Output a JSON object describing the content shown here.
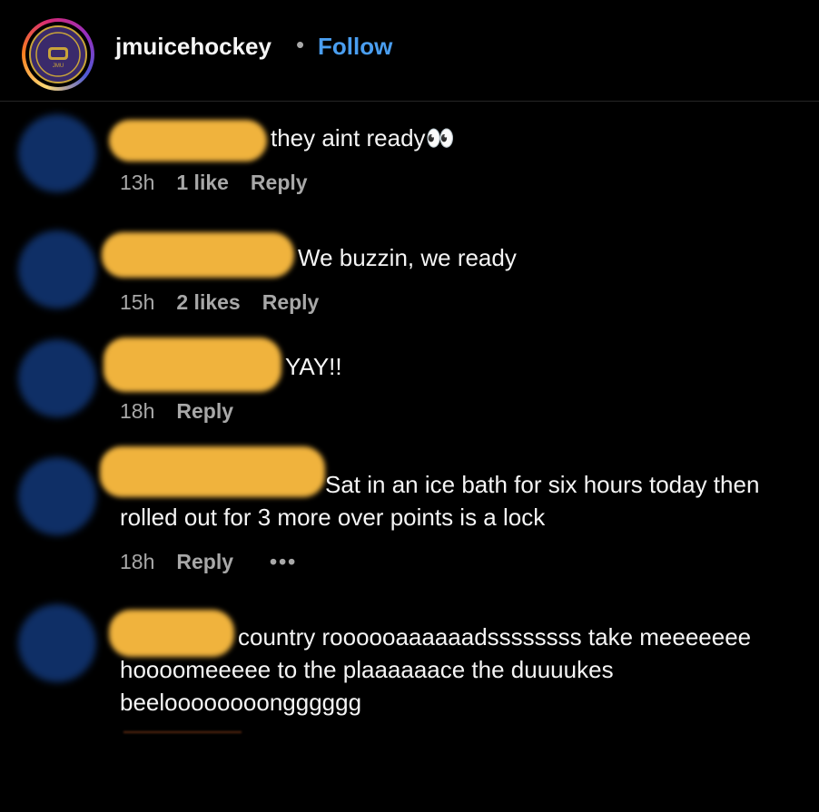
{
  "header": {
    "username": "jmuicehockey",
    "separator": "•",
    "follow_label": "Follow"
  },
  "comments": [
    {
      "text": "they aint ready👀",
      "time": "13h",
      "likes": "1 like",
      "reply": "Reply"
    },
    {
      "text": "We buzzin, we ready",
      "time": "15h",
      "likes": "2 likes",
      "reply": "Reply"
    },
    {
      "text": "YAY!!",
      "time": "18h",
      "reply": "Reply"
    },
    {
      "text_line1": "Sat in an ice bath for six hours today then",
      "text_line2": "rolled out for 3 more over points is a lock",
      "time": "18h",
      "reply": "Reply",
      "more": "•••"
    },
    {
      "text_line1": "country roooooaaaaaadssssssss take meeeeeee",
      "text_line2": "hoooomeeeee to the plaaaaaace the duuuukes",
      "text_line3": "beeloooooooongggggg"
    }
  ],
  "colors": {
    "background": "#000000",
    "follow": "#4a9ef0",
    "redaction": "#f0b33d",
    "avatar_blur": "#0f2f66"
  }
}
